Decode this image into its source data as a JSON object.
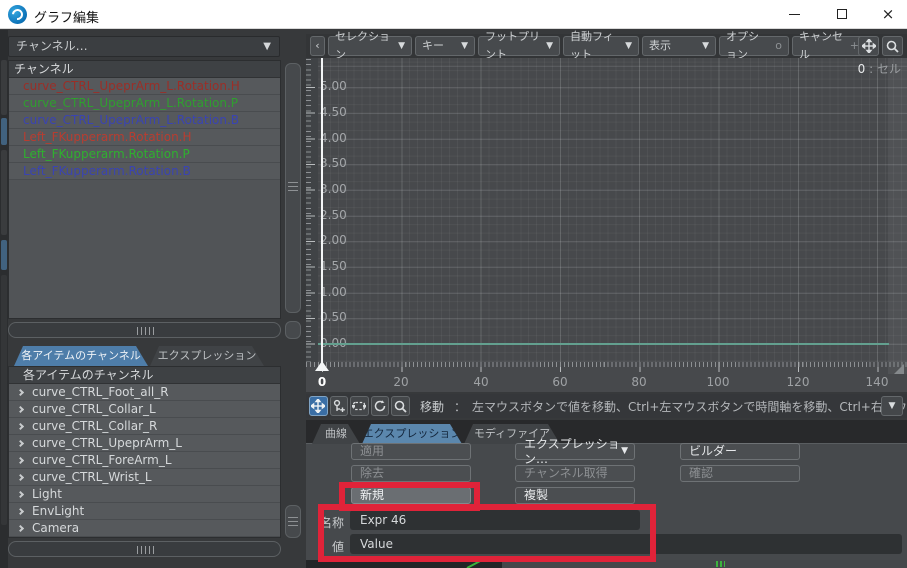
{
  "window": {
    "title": "グラフ編集",
    "close_glyph": "×"
  },
  "left_panel": {
    "channel_dropdown": {
      "label": "チャンネル…"
    },
    "channel_list": {
      "header": "チャンネル",
      "items": [
        {
          "label": "curve_CTRL_UpeprArm_L.Rotation.H",
          "color": "#9b2e27"
        },
        {
          "label": "curve_CTRL_UpeprArm_L.Rotation.P",
          "color": "#2f9f2f"
        },
        {
          "label": "curve_CTRL_UpeprArm_L.Rotation.B",
          "color": "#3a44b2"
        },
        {
          "label": "Left_FKupperarm.Rotation.H",
          "color": "#b83d31"
        },
        {
          "label": "Left_FKupperarm.Rotation.P",
          "color": "#2fb02f"
        },
        {
          "label": "Left_FKupperarm.Rotation.B",
          "color": "#3a44b2"
        }
      ]
    },
    "tabs": {
      "items_channels": "各アイテムのチャンネル",
      "expressions": "エクスプレッション"
    },
    "item_tree": {
      "header": "各アイテムのチャンネル",
      "items": [
        "curve_CTRL_Foot_all_R",
        "curve_CTRL_Collar_L",
        "curve_CTRL_Collar_R",
        "curve_CTRL_UpeprArm_L",
        "curve_CTRL_ForeArm_L",
        "curve_CTRL_Wrist_L",
        "Light",
        "EnvLight",
        "Camera"
      ]
    }
  },
  "graph": {
    "toolbar": {
      "back": "‹",
      "selection": "セレクション",
      "key": "キー",
      "footprint": "フットプリント",
      "autofit": "自動フィット",
      "display": "表示",
      "options": "オプション",
      "options_shortcut": "o",
      "cancel": "キャンセル",
      "cancel_shortcut": "+U"
    },
    "status": {
      "frame": "0",
      "unit": ": セル"
    },
    "axes": {
      "y_ticks": [
        "5.00",
        "4.50",
        "4.00",
        "3.50",
        "3.00",
        "2.50",
        "2.00",
        "1.50",
        "1.00",
        "0.50",
        "0.00"
      ],
      "x_ticks": [
        "0",
        "20",
        "40",
        "60",
        "80",
        "100",
        "120",
        "140"
      ],
      "zero_line_value": "0.00",
      "cursor_frame": "0"
    },
    "tools": {
      "mode": "移動",
      "separator": "：",
      "hint": "左マウスボタンで値を移動、Ctrl+左マウスボタンで時間軸を移動、Ctrl+右マウスボタンで…"
    }
  },
  "bottom_panel": {
    "tabs": {
      "curve": "曲線",
      "expression": "エクスプレッション",
      "modifier": "モディファイア"
    },
    "buttons": {
      "apply": "適用",
      "remove": "除去",
      "new": "新規",
      "expression_menu": "エクスプレッション…",
      "get_channel": "チャンネル取得",
      "duplicate": "複製",
      "builder": "ビルダー",
      "confirm": "確認"
    },
    "fields": {
      "name_label": "名称",
      "name_value": "Expr 46",
      "value_label": "値",
      "value_value": "Value"
    }
  },
  "colors": {
    "accent_tab_blue": "#4e7da9",
    "active_tool_blue": "#3a6ea5",
    "highlight_red": "#e02339",
    "zero_line_teal": "#63a08f",
    "channel_h_red": "#9b2e27",
    "channel_p_green": "#2f9f2f",
    "channel_b_blue": "#3a44b2"
  }
}
